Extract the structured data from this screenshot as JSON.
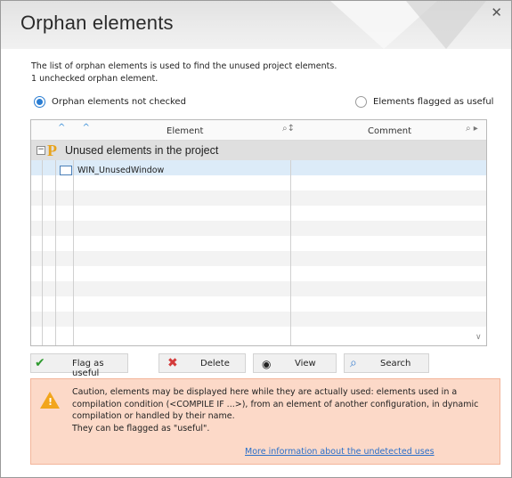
{
  "window": {
    "title": "Orphan elements",
    "close_glyph": "✕"
  },
  "description": {
    "line1": "The list of orphan elements is used to find the unused project elements.",
    "line2": "1 unchecked orphan element."
  },
  "filters": {
    "not_checked": {
      "label": "Orphan elements not checked",
      "selected": true
    },
    "flagged": {
      "label": "Elements flagged as useful",
      "selected": false
    }
  },
  "table": {
    "sort_glyphs": "^ ^",
    "columns": {
      "element": "Element",
      "comment": "Comment"
    },
    "search_icon": "search-icon",
    "group": {
      "label": "Unused elements in the project",
      "icon": "p-project-icon",
      "expander": "−"
    },
    "rows": [
      {
        "element": "WIN_UnusedWindow",
        "comment": "",
        "icon": "window-icon"
      }
    ]
  },
  "toolbar": {
    "flag_label": "Flag as useful",
    "delete_label": "Delete",
    "view_label": "View",
    "search_label": "Search"
  },
  "warning": {
    "line1": "Caution, elements may be displayed here while they are actually used: elements used in a",
    "line2": "compilation condition (<COMPILE IF ...>), from an element of another configuration, in dynamic",
    "line3": "compilation or handled by their name.",
    "line4": "They can be flagged as \"useful\".",
    "link": "More information about the undetected uses"
  },
  "colors": {
    "accent": "#2a7dd2",
    "warning_bg": "#fcd9c8",
    "warning_icon": "#f2a51c",
    "group_bg": "#dfdfdf",
    "selected_row": "#dcebf8"
  }
}
